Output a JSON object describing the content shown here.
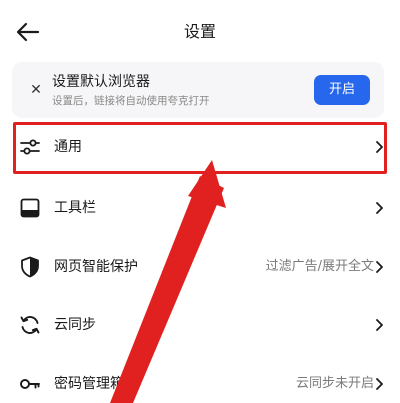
{
  "header": {
    "title": "设置",
    "back_icon": "arrow-left-icon"
  },
  "promo": {
    "title": "设置默认浏览器",
    "subtitle": "设置后，链接将自动使用夸克打开",
    "button_label": "开启",
    "close_icon": "close-icon",
    "button_color": "#2667ee"
  },
  "settings": {
    "items": [
      {
        "label": "通用",
        "value": "",
        "icon": "sliders-icon"
      },
      {
        "label": "工具栏",
        "value": "",
        "icon": "toolbar-icon"
      },
      {
        "label": "网页智能保护",
        "value": "过滤广告/展开全文",
        "icon": "shield-icon"
      },
      {
        "label": "云同步",
        "value": "",
        "icon": "sync-icon"
      },
      {
        "label": "密码管理箱",
        "value": "云同步未开启",
        "icon": "key-icon"
      }
    ]
  },
  "annotation": {
    "highlight_color": "#e0211f"
  }
}
